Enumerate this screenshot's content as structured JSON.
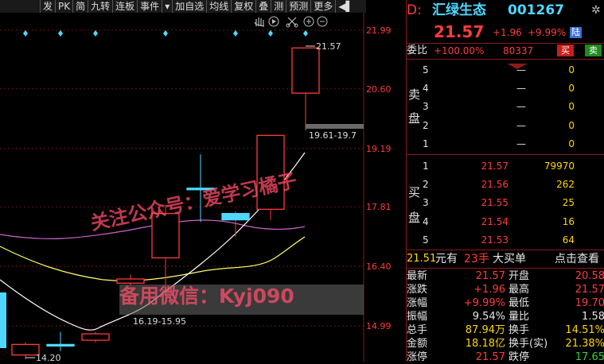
{
  "toolbar": {
    "items": [
      "发",
      "PK",
      "简",
      "九转",
      "连板",
      "事件",
      "▾",
      "加自选",
      "均线",
      "复权",
      "叠",
      "测",
      "预测",
      "更多",
      "◀▌"
    ],
    "right_icons": [
      "hand-icon",
      "play-icon",
      "scissors-icon",
      "plus-circle-icon",
      "minus-circle-icon"
    ]
  },
  "chart": {
    "price_labels": [
      "21.99",
      "20.60",
      "19.19",
      "17.81",
      "16.40",
      "14.99"
    ],
    "annotations": {
      "high": "21.57",
      "limit_range": "19.61-19.7",
      "support_range": "16.19-15.95",
      "low": "14.20"
    },
    "candles": [
      {
        "o": 14.55,
        "c": 14.3,
        "h": 14.6,
        "l": 14.2,
        "dir": "down"
      },
      {
        "o": 14.55,
        "c": 14.55,
        "h": 14.85,
        "l": 14.4,
        "dir": "doji"
      },
      {
        "o": 14.8,
        "c": 14.65,
        "h": 14.85,
        "l": 14.6,
        "dir": "down"
      },
      {
        "o": 16.1,
        "c": 16.0,
        "h": 16.2,
        "l": 15.95,
        "dir": "down"
      },
      {
        "o": 16.6,
        "c": 17.65,
        "h": 17.85,
        "l": 15.7,
        "dir": "up"
      },
      {
        "o": 18.25,
        "c": 18.25,
        "h": 19.05,
        "l": 17.45,
        "dir": "doji"
      },
      {
        "o": 17.5,
        "c": 17.65,
        "h": 17.7,
        "l": 17.1,
        "dir": "flat"
      },
      {
        "o": 17.75,
        "c": 19.5,
        "h": 19.5,
        "l": 17.5,
        "dir": "up"
      },
      {
        "o": 20.5,
        "c": 21.57,
        "h": 21.57,
        "l": 19.61,
        "dir": "up"
      }
    ],
    "ylim": [
      14.0,
      22.5
    ],
    "colors": {
      "up": "#ff3b3b",
      "down": "#4fd8ff",
      "ma1": "#ffffff",
      "ma2": "#ffff66",
      "ma3": "#cc66cc",
      "diamond": "#4fd8ff"
    }
  },
  "watermark": {
    "line1": "关注公众号：爱学习橘子",
    "line2": "备用微信：Kyj090"
  },
  "quote": {
    "code_prefix": "D:",
    "name": "汇绿生态",
    "code": "001267",
    "price": "21.57",
    "change": "+1.96",
    "change_pct": "+9.99%",
    "market_tag": "陆",
    "weibi_label": "委比",
    "weibi_value": "+100.00%",
    "weicha_value": "80337",
    "buy_btn": "买",
    "sell_btn": "卖"
  },
  "sell_side_label": [
    "卖",
    "盘"
  ],
  "buy_side_label": [
    "买",
    "盘"
  ],
  "asks": [
    {
      "level": "5",
      "price": "—",
      "vol": "0"
    },
    {
      "level": "4",
      "price": "—",
      "vol": "0"
    },
    {
      "level": "3",
      "price": "—",
      "vol": "0"
    },
    {
      "level": "2",
      "price": "—",
      "vol": "0"
    },
    {
      "level": "1",
      "price": "—",
      "vol": "0"
    }
  ],
  "bids": [
    {
      "level": "1",
      "price": "21.57",
      "vol": "79970"
    },
    {
      "level": "2",
      "price": "21.56",
      "vol": "262"
    },
    {
      "level": "3",
      "price": "21.55",
      "vol": "25"
    },
    {
      "level": "4",
      "price": "21.54",
      "vol": "16"
    },
    {
      "level": "5",
      "price": "21.53",
      "vol": "64"
    }
  ],
  "big_order": {
    "amount": "21.51",
    "amount_unit": "元有",
    "lots": "23手",
    "label": "大买单",
    "link": "点击查看"
  },
  "stats": [
    {
      "l1": "最新",
      "v1": "21.57",
      "c1": "red",
      "l2": "开盘",
      "v2": "20.58",
      "c2": "red"
    },
    {
      "l1": "涨跌",
      "v1": "+1.96",
      "c1": "red",
      "l2": "最高",
      "v2": "21.57",
      "c2": "red"
    },
    {
      "l1": "涨幅",
      "v1": "+9.99%",
      "c1": "red",
      "l2": "最低",
      "v2": "19.70",
      "c2": "red"
    },
    {
      "l1": "振幅",
      "v1": "9.54%",
      "c1": "white",
      "l2": "量比",
      "v2": "1.58",
      "c2": "white"
    },
    {
      "l1": "总手",
      "v1": "87.94万",
      "c1": "yellow",
      "l2": "换手",
      "v2": "14.51%",
      "c2": "yellow"
    },
    {
      "l1": "金额",
      "v1": "18.18亿",
      "c1": "yellow",
      "l2": "换手(实)",
      "v2": "21.38%",
      "c2": "yellow"
    },
    {
      "l1": "涨停",
      "v1": "21.57",
      "c1": "red",
      "l2": "跌停",
      "v2": "17.65",
      "c2": "green"
    }
  ]
}
